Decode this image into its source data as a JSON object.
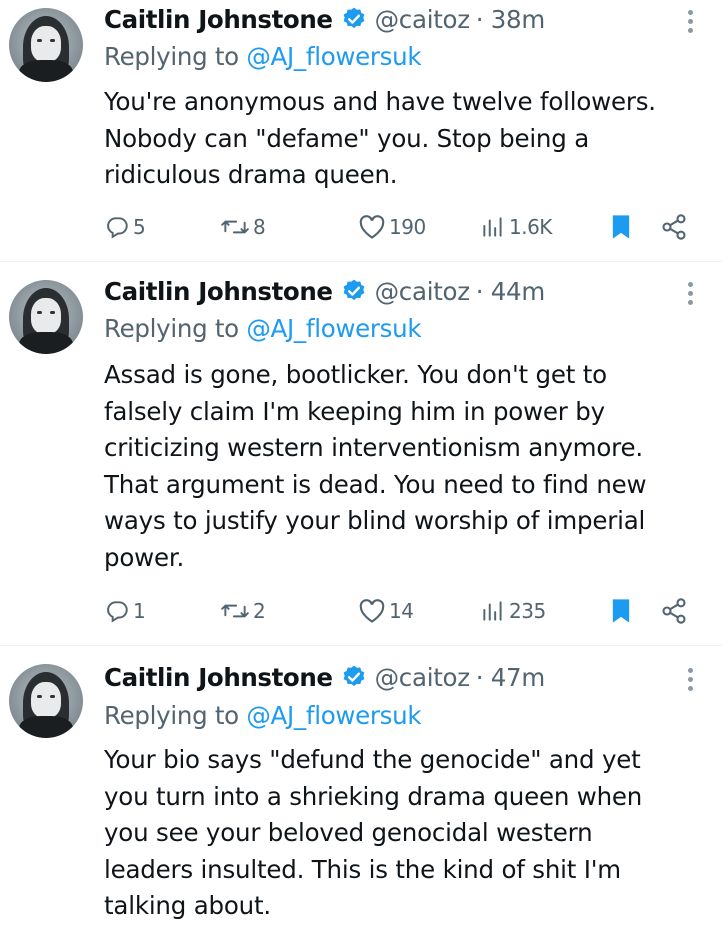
{
  "tweets": [
    {
      "name": "Caitlin Johnstone",
      "handle": "@caitoz",
      "time": "· 38m",
      "replying_prefix": "Replying to",
      "replying_to": "@AJ_flowersuk",
      "text_lines": [
        "You're anonymous and have twelve followers.",
        "Nobody can \"defame\" you. Stop being a",
        "ridiculous drama queen."
      ],
      "replies": "5",
      "reposts": "8",
      "likes": "190",
      "views": "1.6K"
    },
    {
      "name": "Caitlin Johnstone",
      "handle": "@caitoz",
      "time": "· 44m",
      "replying_prefix": "Replying to",
      "replying_to": "@AJ_flowersuk",
      "text_lines": [
        "Assad is gone, bootlicker. You don't get to",
        "falsely claim I'm keeping him in power by",
        "criticizing western interventionism anymore.",
        "That argument is dead. You need to find new",
        "ways to justify your blind worship of imperial",
        "power."
      ],
      "replies": "1",
      "reposts": "2",
      "likes": "14",
      "views": "235"
    },
    {
      "name": "Caitlin Johnstone",
      "handle": "@caitoz",
      "time": "· 47m",
      "replying_prefix": "Replying to",
      "replying_to": "@AJ_flowersuk",
      "text_lines": [
        "Your bio says \"defund the genocide\" and yet",
        "you turn into a shrieking drama queen when",
        "you see your beloved genocidal western",
        "leaders insulted. This is the kind of shit I'm",
        "talking about."
      ]
    }
  ],
  "icons": {
    "reply": "speech-bubble-icon",
    "repost": "repost-arrows-icon",
    "like": "heart-icon",
    "views": "bar-chart-icon",
    "bookmark": "bookmark-icon",
    "share": "share-icon",
    "verified": "verified-badge-icon",
    "more": "more-vertical-icon"
  },
  "colors": {
    "accent": "#1d9bf0",
    "secondary_text": "#536471",
    "primary_text": "#0f1419"
  }
}
